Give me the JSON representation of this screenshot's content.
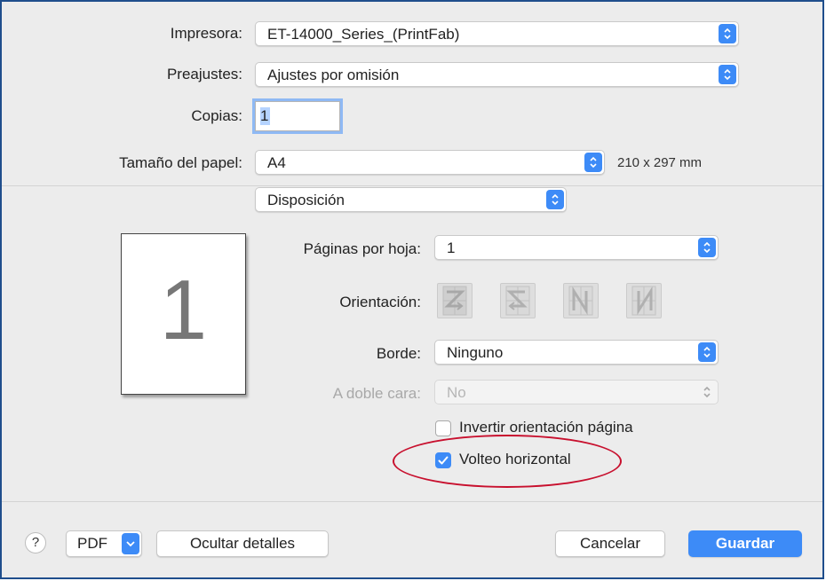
{
  "printer": {
    "label": "Impresora:",
    "value": "ET-14000_Series_(PrintFab)"
  },
  "presets": {
    "label": "Preajustes:",
    "value": "Ajustes por omisión"
  },
  "copies": {
    "label": "Copias:",
    "value": "1"
  },
  "paper_size": {
    "label": "Tamaño del papel:",
    "value": "A4",
    "dimensions": "210 x 297 mm"
  },
  "section": {
    "value": "Disposición"
  },
  "preview": {
    "page_number": "1"
  },
  "layout": {
    "pages_per_sheet": {
      "label": "Páginas por hoja:",
      "value": "1"
    },
    "orientation": {
      "label": "Orientación:",
      "icons": [
        "z-order-icon",
        "reverse-z-order-icon",
        "n-order-icon",
        "reverse-n-order-icon"
      ]
    },
    "border": {
      "label": "Borde:",
      "value": "Ninguno"
    },
    "two_sided": {
      "label": "A doble cara:",
      "value": "No"
    },
    "reverse_orientation": {
      "label": "Invertir orientación página",
      "checked": false
    },
    "flip_horizontal": {
      "label": "Volteo horizontal",
      "checked": true
    }
  },
  "footer": {
    "help": "?",
    "pdf": "PDF",
    "hide_details": "Ocultar detalles",
    "cancel": "Cancelar",
    "save": "Guardar"
  },
  "colors": {
    "accent": "#3d8bf7",
    "annotation": "#c8102e",
    "frame": "#1f4e8c"
  }
}
